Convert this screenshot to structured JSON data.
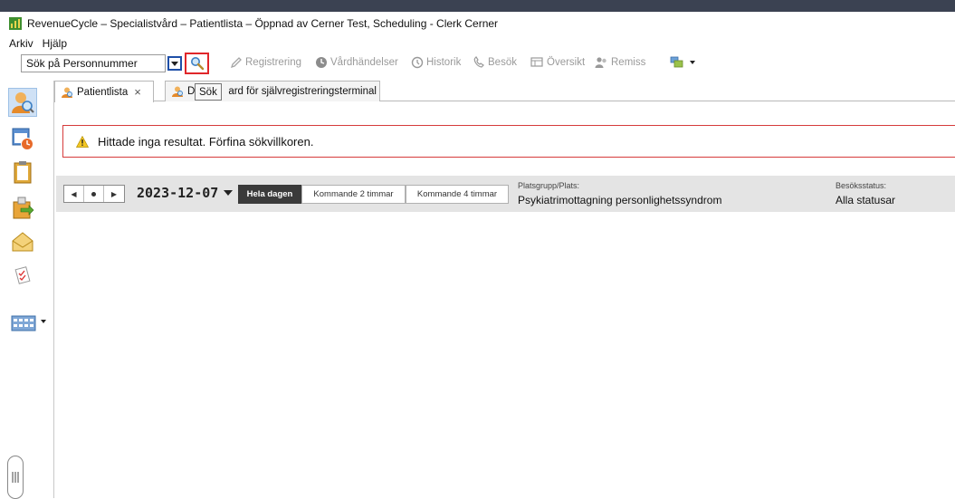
{
  "window": {
    "title": "RevenueCycle – Specialistvård – Patientlista – Öppnad av Cerner Test, Scheduling - Clerk Cerner"
  },
  "menu": [
    {
      "label": "Arkiv"
    },
    {
      "label": "Hjälp"
    }
  ],
  "toolbar": {
    "search_value": "Sök på Personnummer",
    "search_tooltip": "Sök",
    "actions": [
      {
        "label": "Registrering",
        "icon": "pen-icon"
      },
      {
        "label": "Vårdhändelser",
        "icon": "clock-circle-icon"
      },
      {
        "label": "Historik",
        "icon": "history-icon"
      },
      {
        "label": "Besök",
        "icon": "phone-icon"
      },
      {
        "label": "Översikt",
        "icon": "overview-icon"
      },
      {
        "label": "Remiss",
        "icon": "users-icon"
      }
    ]
  },
  "tabs": [
    {
      "label": "Patientlista",
      "close": "×"
    },
    {
      "label_prefix": "D",
      "label_suffix": "ard för självregistreringsterminal"
    }
  ],
  "alert": {
    "message": "Hittade inga resultat. Förfina sökvillkoren."
  },
  "datebar": {
    "date": "2023-12-07",
    "ranges": [
      {
        "label": "Hela dagen"
      },
      {
        "label": "Kommande 2 timmar"
      },
      {
        "label": "Kommande 4 timmar"
      }
    ],
    "location_label": "Platsgrupp/Plats:",
    "location_value": "Psykiatrimottagning personlighetssyndrom",
    "status_label": "Besöksstatus:",
    "status_value": "Alla statusar"
  },
  "colors": {
    "alert_border": "#d63b3b",
    "highlight_red": "#e0262a",
    "highlight_blue": "#1f4fa8",
    "active_range": "#3a3a3a"
  }
}
